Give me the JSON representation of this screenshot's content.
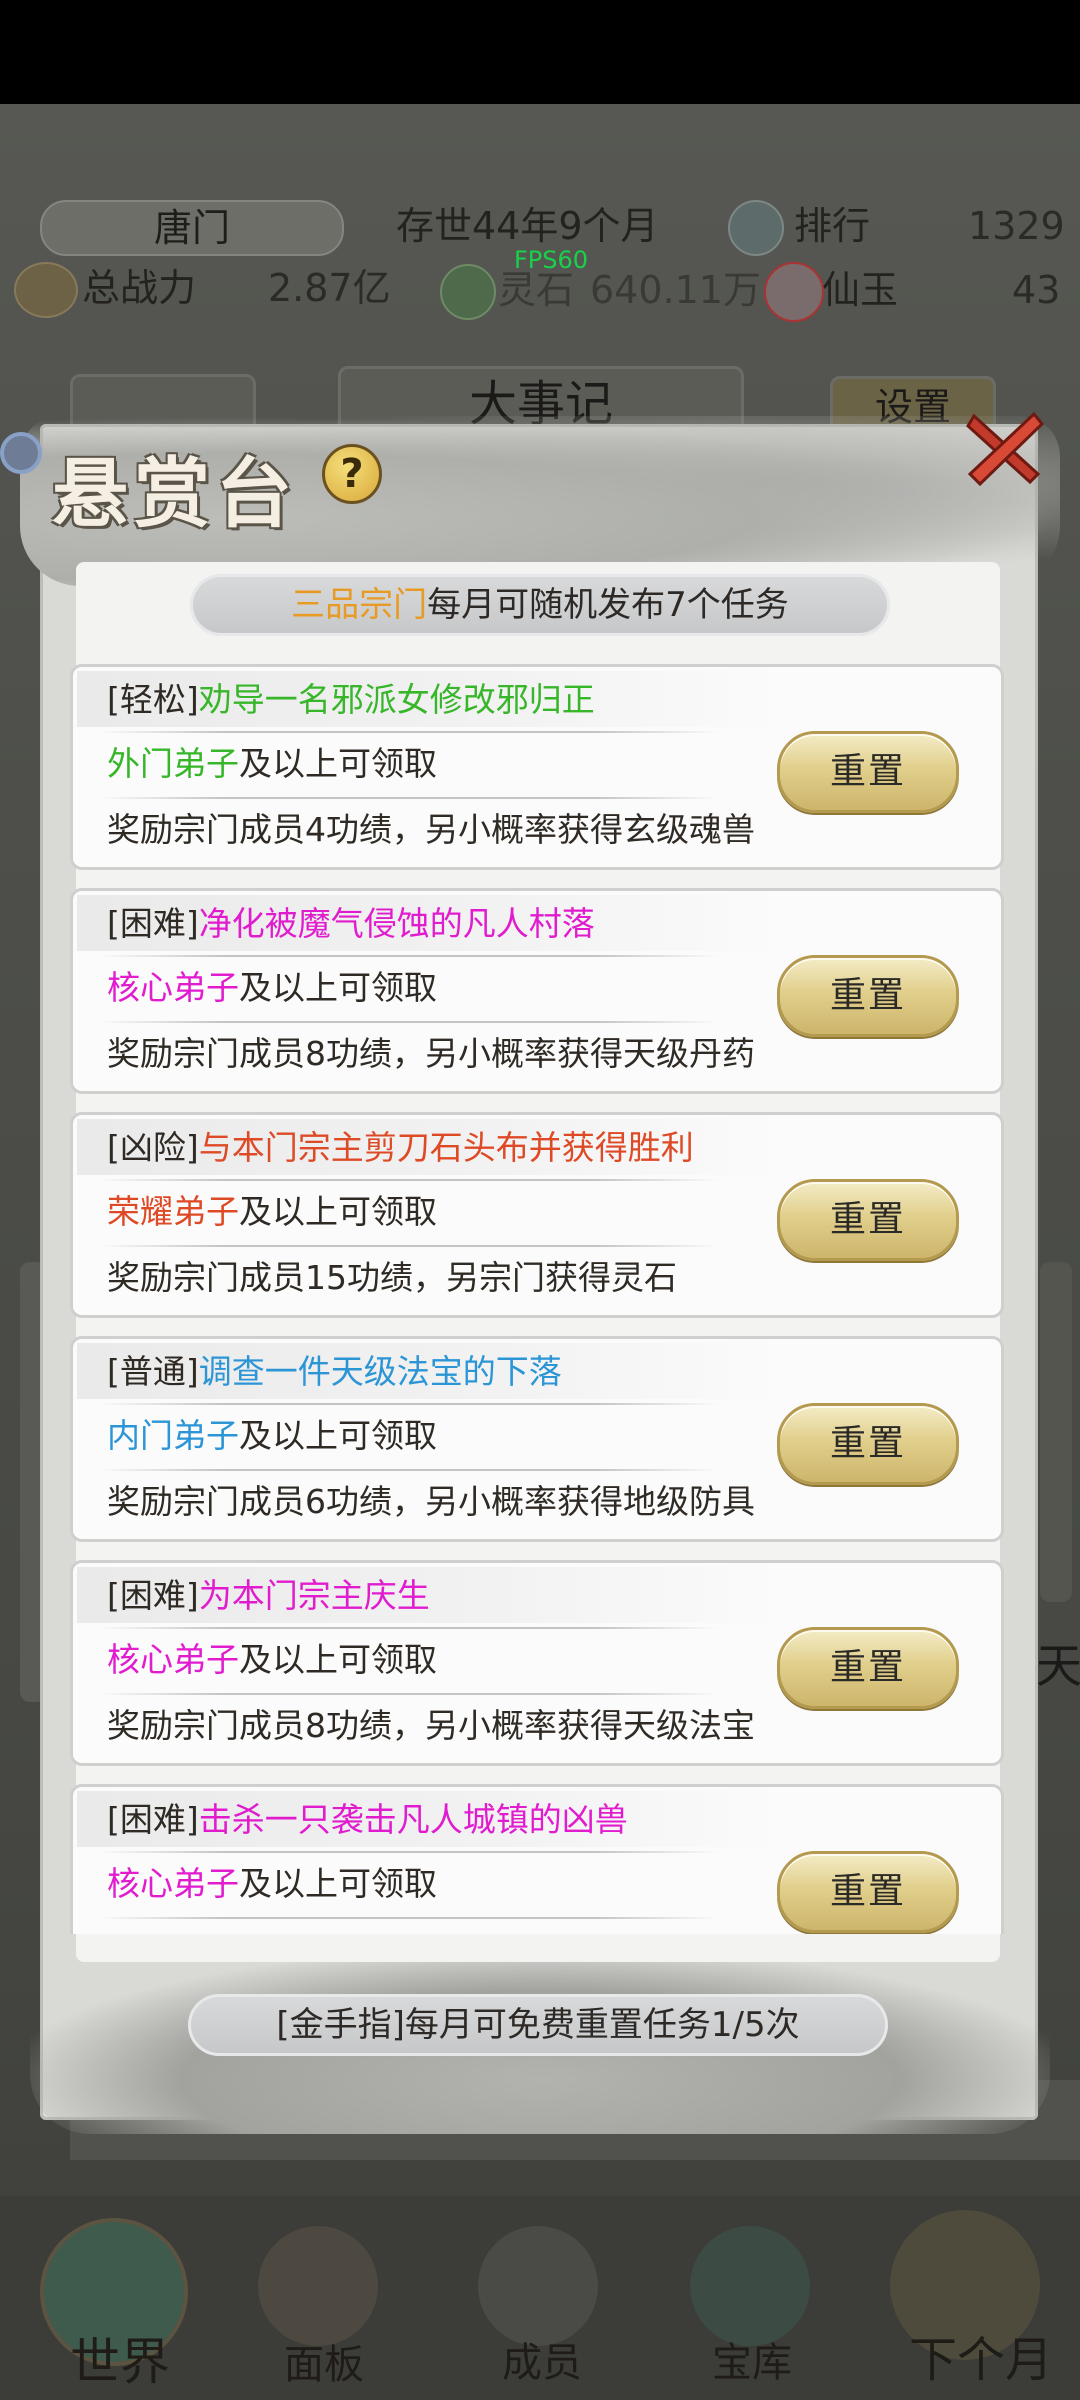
{
  "header": {
    "sect_name": "唐门",
    "age": "存世44年9个月",
    "rank_label": "排行",
    "rank_value": "1329",
    "power_label": "总战力",
    "power_value": "2.87亿",
    "spirit_stone_label": "灵石",
    "spirit_stone_value": "640.11万",
    "jade_label": "仙玉",
    "jade_value": "43",
    "fps": "FPS60"
  },
  "background": {
    "tab_left": "",
    "tab_center": "大事记",
    "tab_right": "设置",
    "row_buttons": [
      "",
      "",
      "",
      ""
    ],
    "bottom_row": [
      "",
      "",
      ""
    ],
    "side_char": "天",
    "nav": [
      "世界",
      "面板",
      "成员",
      "宝库",
      "下个月"
    ]
  },
  "modal": {
    "title": "悬赏台",
    "help_label": "?",
    "banner_highlight": "三品宗门",
    "banner_text": "每月可随机发布7个任务",
    "reset_label": "重置",
    "footer_text": "[金手指]每月可免费重置任务1/5次",
    "colors": {
      "easy": "#37b62a",
      "hard": "#e11ccf",
      "danger": "#de4a26",
      "normal": "#2c95d6",
      "outer": "#37b62a",
      "core": "#e11ccf",
      "honor": "#de4a26",
      "inner": "#2c95d6"
    },
    "tasks": [
      {
        "difficulty": "[轻松]",
        "title": "劝导一名邪派女修改邪归正",
        "color": "#37b62a",
        "rank": "外门弟子",
        "rank_color": "#37b62a",
        "rank_suffix": "及以上可领取",
        "reward": "奖励宗门成员4功绩，另小概率获得玄级魂兽"
      },
      {
        "difficulty": "[困难]",
        "title": "净化被魔气侵蚀的凡人村落",
        "color": "#e11ccf",
        "rank": "核心弟子",
        "rank_color": "#e11ccf",
        "rank_suffix": "及以上可领取",
        "reward": "奖励宗门成员8功绩，另小概率获得天级丹药"
      },
      {
        "difficulty": "[凶险]",
        "title": "与本门宗主剪刀石头布并获得胜利",
        "color": "#de4a26",
        "rank": "荣耀弟子",
        "rank_color": "#de4a26",
        "rank_suffix": "及以上可领取",
        "reward": "奖励宗门成员15功绩，另宗门获得灵石"
      },
      {
        "difficulty": "[普通]",
        "title": "调查一件天级法宝的下落",
        "color": "#2c95d6",
        "rank": "内门弟子",
        "rank_color": "#2c95d6",
        "rank_suffix": "及以上可领取",
        "reward": "奖励宗门成员6功绩，另小概率获得地级防具"
      },
      {
        "difficulty": "[困难]",
        "title": "为本门宗主庆生",
        "color": "#e11ccf",
        "rank": "核心弟子",
        "rank_color": "#e11ccf",
        "rank_suffix": "及以上可领取",
        "reward": "奖励宗门成员8功绩，另小概率获得天级法宝"
      },
      {
        "difficulty": "[困难]",
        "title": "击杀一只袭击凡人城镇的凶兽",
        "color": "#e11ccf",
        "rank": "核心弟子",
        "rank_color": "#e11ccf",
        "rank_suffix": "及以上可领取",
        "reward": ""
      }
    ]
  }
}
